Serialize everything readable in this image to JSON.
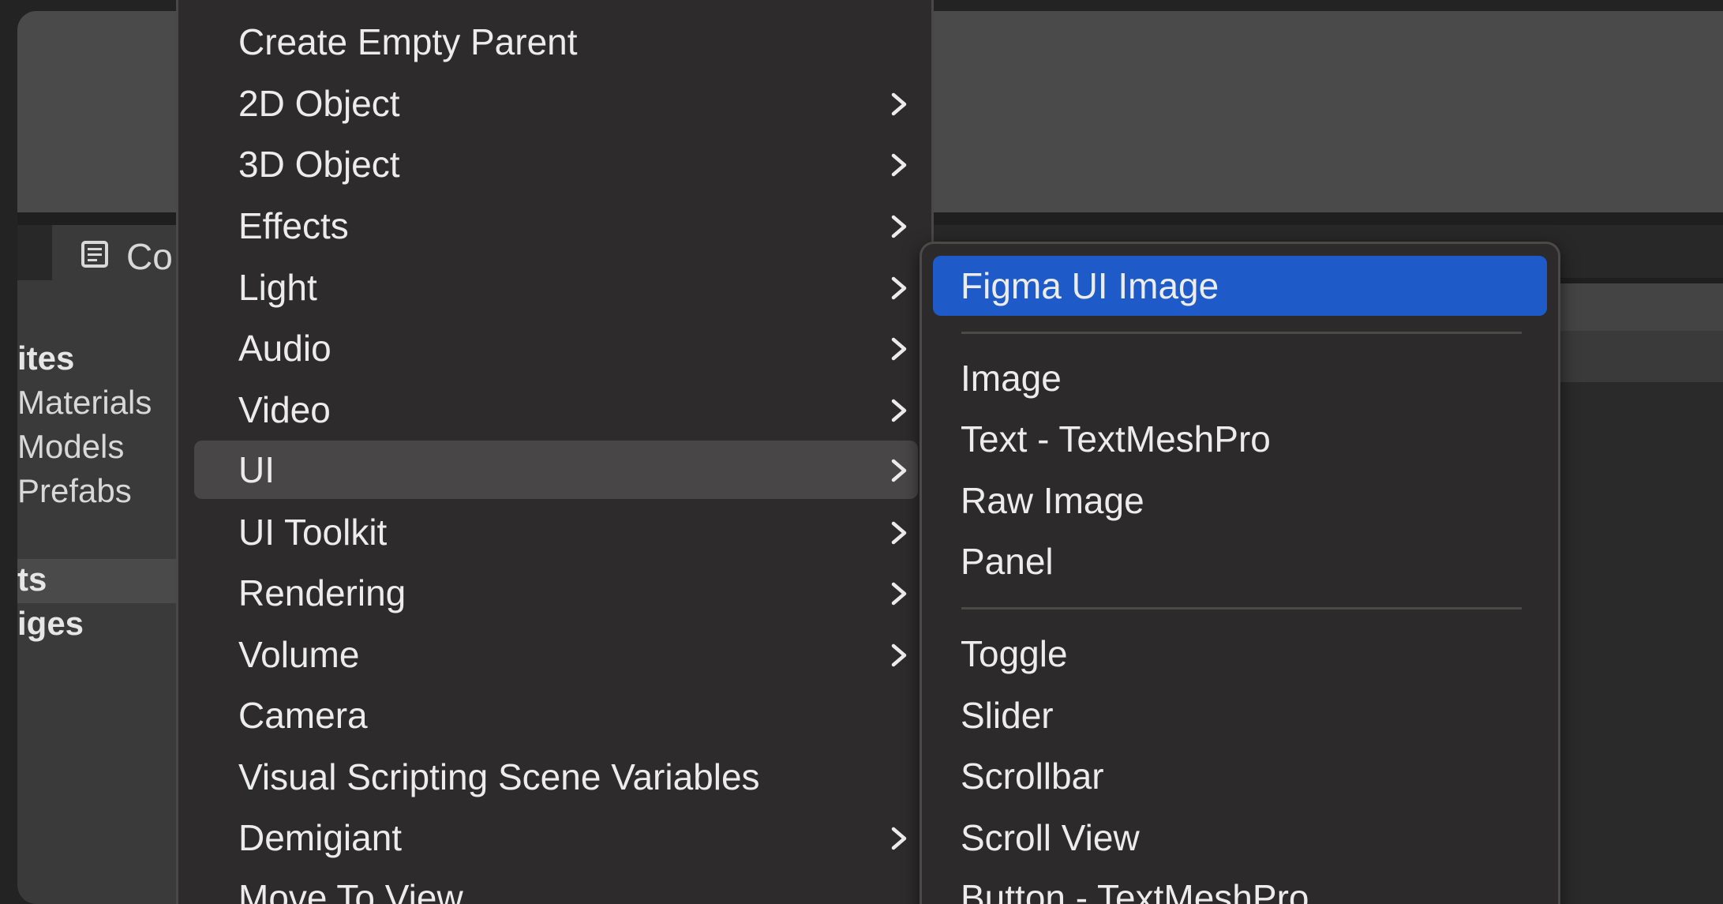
{
  "colors": {
    "menu_background": "#2d2b2b",
    "submenu_background": "#2c2a2a",
    "menu_highlight": "#484646",
    "selection_blue": "#1f5bc8",
    "menu_text": "#ececec",
    "editor_background": "#3a3a3a"
  },
  "editor": {
    "console_tab": {
      "icon": "console-list-icon",
      "label": "Co"
    },
    "project_items": [
      {
        "label": "ites"
      },
      {
        "label": "Materials"
      },
      {
        "label": "Models"
      },
      {
        "label": "Prefabs"
      },
      {
        "label": "ts"
      },
      {
        "label": "iges"
      }
    ]
  },
  "context_menu": {
    "items": [
      {
        "label": "Create Empty Parent",
        "has_submenu": false
      },
      {
        "label": "2D Object",
        "has_submenu": true
      },
      {
        "label": "3D Object",
        "has_submenu": true
      },
      {
        "label": "Effects",
        "has_submenu": true
      },
      {
        "label": "Light",
        "has_submenu": true
      },
      {
        "label": "Audio",
        "has_submenu": true
      },
      {
        "label": "Video",
        "has_submenu": true
      },
      {
        "label": "UI",
        "has_submenu": true,
        "highlighted": true
      },
      {
        "label": "UI Toolkit",
        "has_submenu": true
      },
      {
        "label": "Rendering",
        "has_submenu": true
      },
      {
        "label": "Volume",
        "has_submenu": true
      },
      {
        "label": "Camera",
        "has_submenu": false
      },
      {
        "label": "Visual Scripting Scene Variables",
        "has_submenu": false
      },
      {
        "label": "Demigiant",
        "has_submenu": true
      },
      {
        "label": "Move To View",
        "has_submenu": false
      }
    ]
  },
  "ui_submenu": {
    "items": [
      {
        "label": "Figma UI Image",
        "selected": true
      },
      {
        "label": "Image"
      },
      {
        "label": "Text - TextMeshPro"
      },
      {
        "label": "Raw Image"
      },
      {
        "label": "Panel"
      },
      {
        "label": "Toggle"
      },
      {
        "label": "Slider"
      },
      {
        "label": "Scrollbar"
      },
      {
        "label": "Scroll View"
      },
      {
        "label": "Button - TextMeshPro"
      }
    ]
  }
}
